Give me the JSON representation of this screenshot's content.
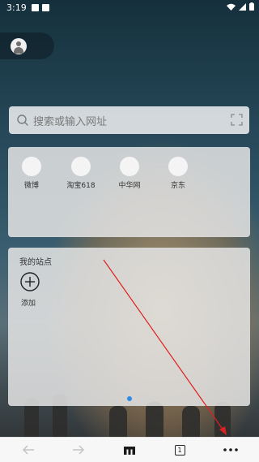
{
  "status_bar": {
    "time": "3:19"
  },
  "search": {
    "placeholder": "搜索或输入网址"
  },
  "quick_links": [
    {
      "label": "微博"
    },
    {
      "label": "淘宝618"
    },
    {
      "label": "中华网"
    },
    {
      "label": "京东"
    }
  ],
  "my_sites": {
    "title": "我的站点",
    "add_label": "添加"
  },
  "pager": {
    "active_page": 1,
    "total_pages": 1
  },
  "bottom_bar": {
    "tab_count": "1"
  },
  "colors": {
    "accent_dot": "#2f8be6",
    "annotation_arrow": "#e0201e"
  }
}
